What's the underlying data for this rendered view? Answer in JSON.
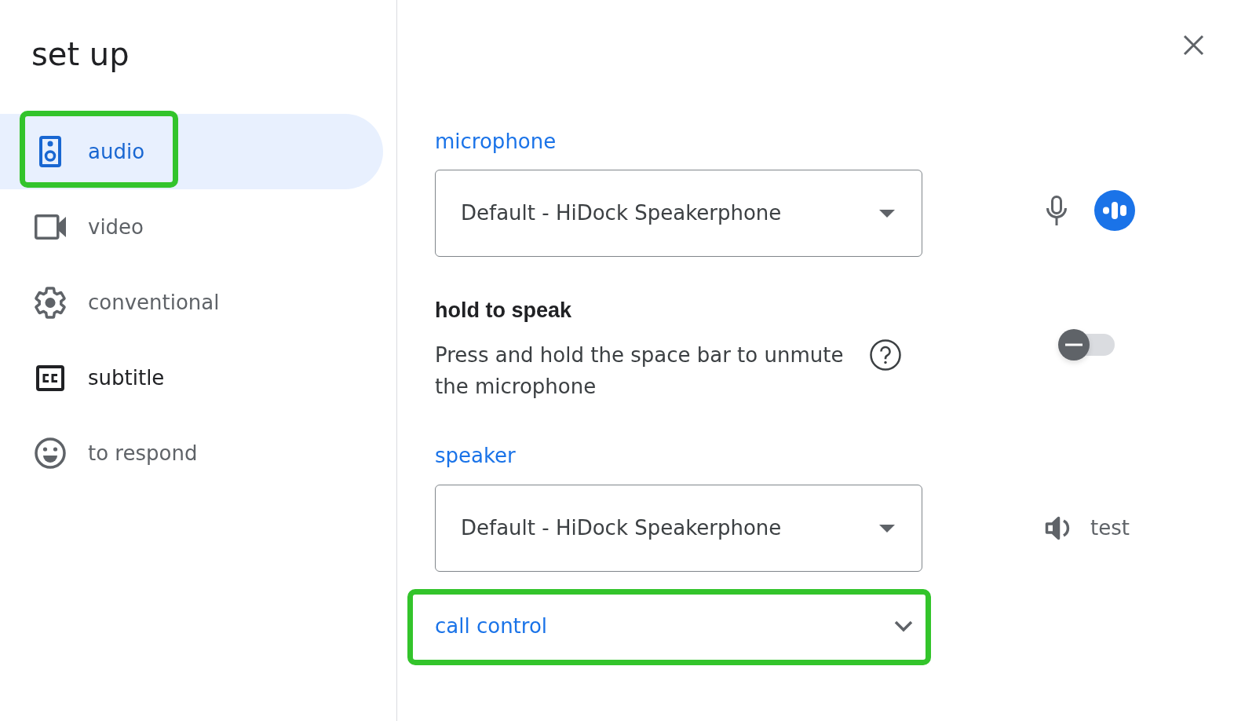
{
  "title": "set up",
  "sidebar": {
    "items": [
      {
        "label": "audio",
        "selected": true,
        "hovered": false,
        "highlighted": true
      },
      {
        "label": "video",
        "selected": false,
        "hovered": false,
        "highlighted": false
      },
      {
        "label": "conventional",
        "selected": false,
        "hovered": false,
        "highlighted": false
      },
      {
        "label": "subtitle",
        "selected": false,
        "hovered": true,
        "highlighted": false
      },
      {
        "label": "to respond",
        "selected": false,
        "hovered": false,
        "highlighted": false
      }
    ]
  },
  "microphone": {
    "label": "microphone",
    "device": "Default - HiDock Speakerphone"
  },
  "hold_to_speak": {
    "title": "hold to speak",
    "description": "Press and hold the space bar to unmute the microphone",
    "on": false
  },
  "speaker": {
    "label": "speaker",
    "device": "Default - HiDock Speakerphone",
    "test_button": "test"
  },
  "call_control": {
    "label": "call control",
    "expanded": false,
    "highlighted": true
  }
}
